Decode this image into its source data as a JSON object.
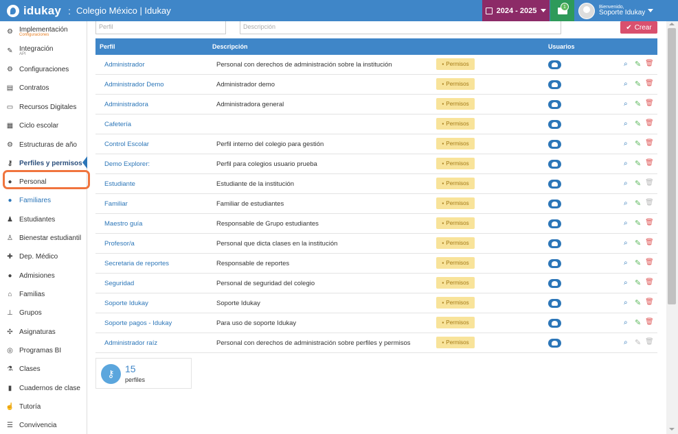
{
  "topbar": {
    "brand": "idukay",
    "separator": ":",
    "school": "Colegio México | Idukay",
    "year": "2024 - 2025",
    "mail_count": "1",
    "welcome": "Bienvenido,",
    "user": "Soporte Idukay"
  },
  "sidebar": {
    "items": [
      {
        "label": "Implementación",
        "sub": "Configuraciones",
        "icon": "gears-icon"
      },
      {
        "label": "Integración",
        "sub": "API",
        "icon": "plug-icon"
      },
      {
        "label": "Configuraciones",
        "icon": "gears-icon"
      },
      {
        "label": "Contratos",
        "icon": "document-icon"
      },
      {
        "label": "Recursos Digitales",
        "icon": "laptop-icon"
      },
      {
        "label": "Ciclo escolar",
        "icon": "calendar-icon"
      },
      {
        "label": "Estructuras de año",
        "icon": "gear-icon"
      },
      {
        "label": "Perfiles y permisos",
        "icon": "key-icon"
      },
      {
        "label": "Personal",
        "icon": "user-icon"
      },
      {
        "label": "Familiares",
        "icon": "user-icon"
      },
      {
        "label": "Estudiantes",
        "icon": "child-icon"
      },
      {
        "label": "Bienestar estudiantil",
        "icon": "wellbeing-icon"
      },
      {
        "label": "Dep. Médico",
        "icon": "medkit-icon"
      },
      {
        "label": "Admisiones",
        "icon": "users-icon"
      },
      {
        "label": "Familias",
        "icon": "home-icon"
      },
      {
        "label": "Grupos",
        "icon": "sitemap-icon"
      },
      {
        "label": "Asignaturas",
        "icon": "puzzle-icon"
      },
      {
        "label": "Programas BI",
        "icon": "globe-icon"
      },
      {
        "label": "Clases",
        "icon": "flask-icon"
      },
      {
        "label": "Cuadernos de clase",
        "icon": "book-icon"
      },
      {
        "label": "Tutoría",
        "icon": "thumbs-up-icon"
      },
      {
        "label": "Convivencia",
        "icon": "list-icon"
      }
    ]
  },
  "filters": {
    "perfil_placeholder": "Perfil",
    "desc_placeholder": "Descripción",
    "create_label": "Crear"
  },
  "table": {
    "headers": {
      "perfil": "Perfil",
      "descripcion": "Descripción",
      "usuarios": "Usuarios"
    },
    "perm_label": "Permisos",
    "rows": [
      {
        "perfil": "Administrador",
        "descripcion": "Personal con derechos de administración sobre la institución",
        "edit": true,
        "delete": true
      },
      {
        "perfil": "Administrador Demo",
        "descripcion": "Administrador demo",
        "edit": true,
        "delete": true
      },
      {
        "perfil": "Administradora",
        "descripcion": "Administradora general",
        "edit": true,
        "delete": true
      },
      {
        "perfil": "Cafetería",
        "descripcion": "",
        "edit": true,
        "delete": true
      },
      {
        "perfil": "Control Escolar",
        "descripcion": "Perfil interno del colegio para gestión",
        "edit": true,
        "delete": true
      },
      {
        "perfil": "Demo Explorer:",
        "descripcion": "Perfil para colegios usuario prueba",
        "edit": true,
        "delete": true
      },
      {
        "perfil": "Estudiante",
        "descripcion": "Estudiante de la institución",
        "edit": true,
        "delete": false
      },
      {
        "perfil": "Familiar",
        "descripcion": "Familiar de estudiantes",
        "edit": true,
        "delete": false
      },
      {
        "perfil": "Maestro guía",
        "descripcion": "Responsable de Grupo estudiantes",
        "edit": true,
        "delete": true
      },
      {
        "perfil": "Profesor/a",
        "descripcion": "Personal que dicta clases en la institución",
        "edit": true,
        "delete": true
      },
      {
        "perfil": "Secretaria de reportes",
        "descripcion": "Responsable de reportes",
        "edit": true,
        "delete": true
      },
      {
        "perfil": "Seguridad",
        "descripcion": "Personal de seguridad del colegio",
        "edit": true,
        "delete": true
      },
      {
        "perfil": "Soporte Idukay",
        "descripcion": "Soporte Idukay",
        "edit": true,
        "delete": true
      },
      {
        "perfil": "Soporte pagos - Idukay",
        "descripcion": "Para uso de soporte Idukay",
        "edit": true,
        "delete": true
      },
      {
        "perfil": "Administrador raíz",
        "descripcion": "Personal con derechos de administración sobre perfiles y permisos",
        "edit": false,
        "delete": false
      }
    ]
  },
  "summary": {
    "count": "15",
    "label": "perfiles"
  }
}
